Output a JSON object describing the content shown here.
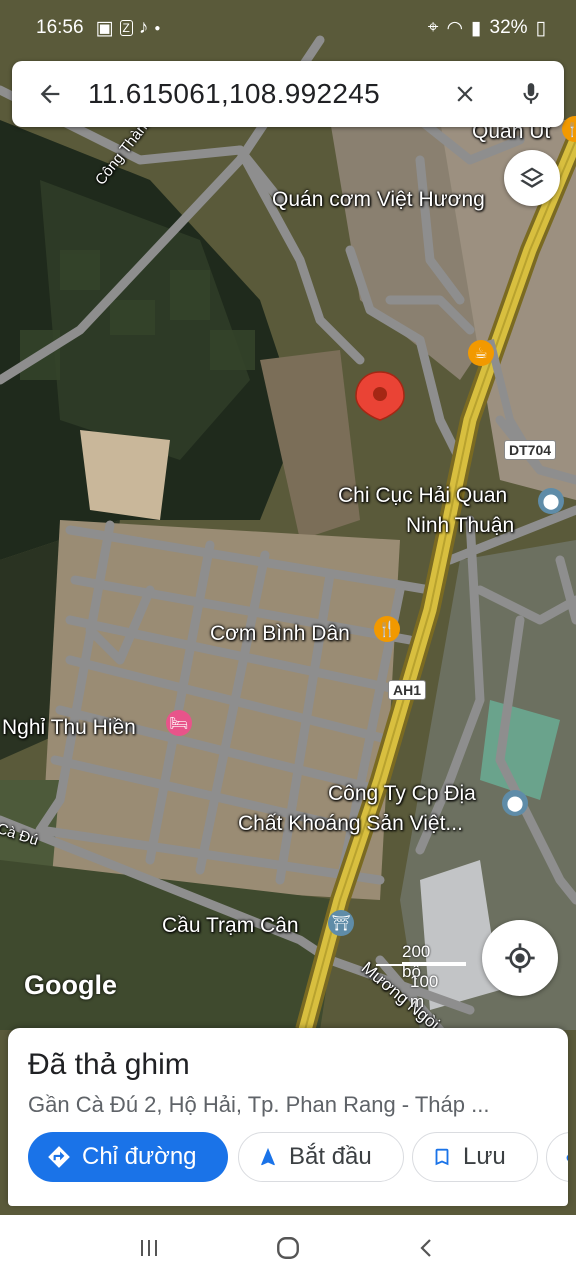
{
  "status_bar": {
    "time": "16:56",
    "battery": "32%"
  },
  "search": {
    "query": "11.615061,108.992245"
  },
  "map": {
    "labels": {
      "quan_ut": "Quán Út",
      "quan_com": "Quán cơm Việt Hương",
      "cong_thanh": "Công Thành - Cà Đú",
      "dt704": "DT704",
      "chi_cuc_1": "Chi Cục Hải Quan",
      "chi_cuc_2": "Ninh Thuận",
      "com_binh_dan": "Cơm Bình Dân",
      "ah1": "AH1",
      "nghi_thu_hien": "Nghỉ Thu Hiền",
      "cong_ty_1": "Công Ty Cp Địa",
      "cong_ty_2": "Chất Khoáng Sản Việt...",
      "ca_du": "Cà Đú",
      "cau_tram_can": "Cầu Trạm Cân",
      "muong_ngoi": "Mương Ngòi"
    },
    "google_logo": "Google",
    "scale_top": "200 bộ",
    "scale_bottom": "100 m"
  },
  "sheet": {
    "title": "Đã thả ghim",
    "address": "Gần Cà Đú 2, Hộ Hải, Tp. Phan Rang - Tháp ...",
    "directions_label": "Chỉ đường",
    "start_label": "Bắt đầu",
    "save_label": "Lưu"
  },
  "colors": {
    "accent": "#1a73e8",
    "pin": "#ea4335",
    "food": "#f29900",
    "info": "#5f8ca8",
    "hotel": "#e8548a"
  }
}
